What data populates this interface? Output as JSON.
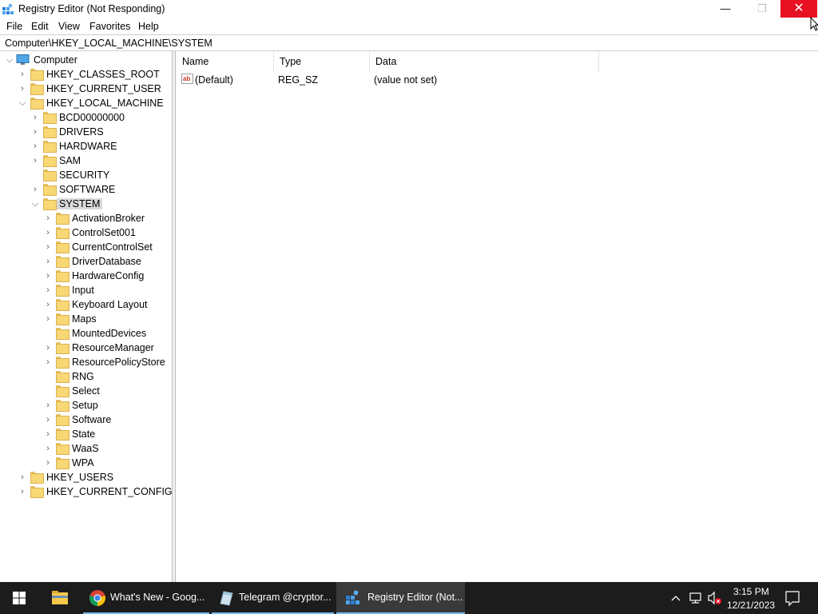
{
  "window": {
    "title": "Registry Editor (Not Responding)",
    "min_glyph": "—",
    "max_glyph": "❐",
    "close_glyph": "✕",
    "accent_close": "#e81123"
  },
  "menu": [
    "File",
    "Edit",
    "View",
    "Favorites",
    "Help"
  ],
  "address": "Computer\\HKEY_LOCAL_MACHINE\\SYSTEM",
  "tree": {
    "root": "Computer",
    "hives": {
      "classes_root": "HKEY_CLASSES_ROOT",
      "current_user": "HKEY_CURRENT_USER",
      "local_machine": "HKEY_LOCAL_MACHINE",
      "users": "HKEY_USERS",
      "current_config": "HKEY_CURRENT_CONFIG"
    },
    "hklm_children": [
      "BCD00000000",
      "DRIVERS",
      "HARDWARE",
      "SAM",
      "SECURITY",
      "SOFTWARE",
      "SYSTEM"
    ],
    "system_children": [
      "ActivationBroker",
      "ControlSet001",
      "CurrentControlSet",
      "DriverDatabase",
      "HardwareConfig",
      "Input",
      "Keyboard Layout",
      "Maps",
      "MountedDevices",
      "ResourceManager",
      "ResourcePolicyStore",
      "RNG",
      "Select",
      "Setup",
      "Software",
      "State",
      "WaaS",
      "WPA"
    ],
    "selected": "SYSTEM"
  },
  "list": {
    "columns": {
      "name": "Name",
      "type": "Type",
      "data": "Data"
    },
    "rows": [
      {
        "name": "(Default)",
        "type": "REG_SZ",
        "data": "(value not set)"
      }
    ]
  },
  "taskbar": {
    "apps": [
      {
        "label": "What's New - Goog...",
        "icon": "chrome-icon"
      },
      {
        "label": "Telegram @cryptor...",
        "icon": "telegram-icon"
      },
      {
        "label": "Registry Editor (Not...",
        "icon": "regedit-icon"
      }
    ],
    "time": "3:15 PM",
    "date": "12/21/2023"
  }
}
